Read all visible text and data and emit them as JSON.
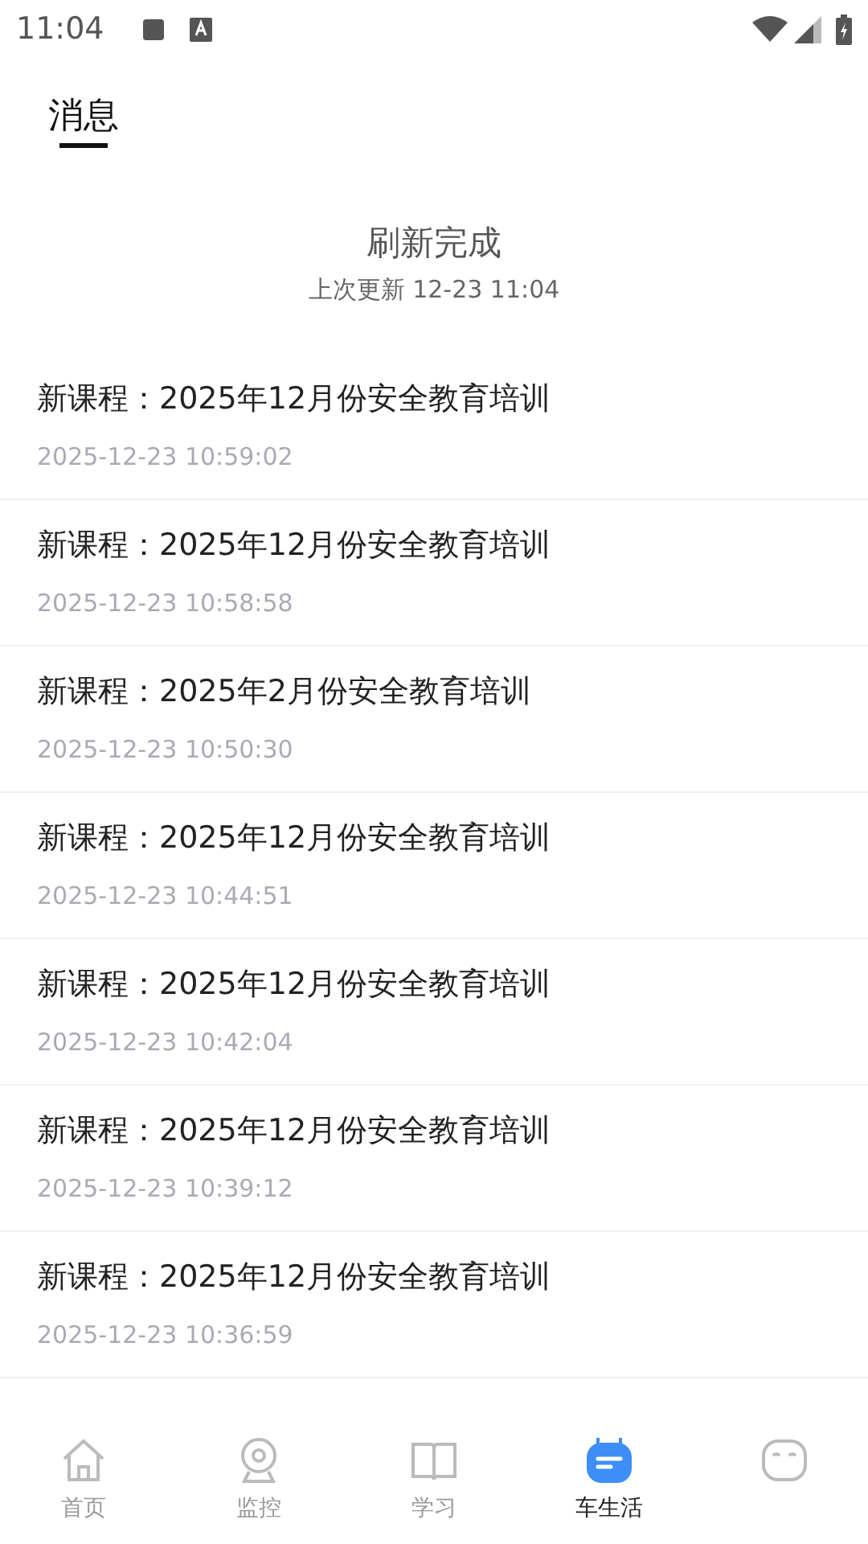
{
  "status_bar": {
    "time": "11:04"
  },
  "header": {
    "title": "消息",
    "selected": true
  },
  "refresh": {
    "title": "刷新完成",
    "subtitle": "上次更新 12-23 11:04"
  },
  "messages": [
    {
      "title": "新课程：2025年12月份安全教育培训",
      "time": "2025-12-23 10:59:02"
    },
    {
      "title": "新课程：2025年12月份安全教育培训",
      "time": "2025-12-23 10:58:58"
    },
    {
      "title": "新课程：2025年2月份安全教育培训",
      "time": "2025-12-23 10:50:30"
    },
    {
      "title": "新课程：2025年12月份安全教育培训",
      "time": "2025-12-23 10:44:51"
    },
    {
      "title": "新课程：2025年12月份安全教育培训",
      "time": "2025-12-23 10:42:04"
    },
    {
      "title": "新课程：2025年12月份安全教育培训",
      "time": "2025-12-23 10:39:12"
    },
    {
      "title": "新课程：2025年12月份安全教育培训",
      "time": "2025-12-23 10:36:59"
    }
  ],
  "bottom_nav": [
    {
      "kind": "home",
      "label": "首页",
      "selected": false
    },
    {
      "kind": "camera",
      "label": "监控",
      "selected": false
    },
    {
      "kind": "book",
      "label": "学习",
      "selected": false
    },
    {
      "kind": "calendar",
      "label": "车生活",
      "selected": true
    },
    {
      "kind": "face",
      "selected": false
    }
  ]
}
